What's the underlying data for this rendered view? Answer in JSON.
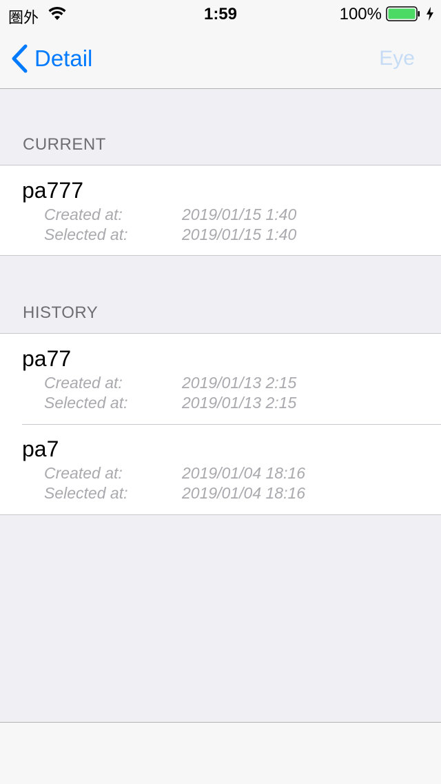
{
  "status_bar": {
    "carrier": "圏外",
    "time": "1:59",
    "battery_percent": "100%",
    "battery_level": 1.0,
    "battery_color": "#4cd964",
    "icons": [
      "wifi-icon",
      "battery-icon",
      "charging-icon"
    ]
  },
  "nav": {
    "back_label": "Detail",
    "right_label": "Eye",
    "tint_color": "#007aff"
  },
  "current": {
    "header": "CURRENT",
    "items": [
      {
        "title": "pa777",
        "created_label": "Created at:",
        "created_value": "2019/01/15 1:40",
        "selected_label": "Selected at:",
        "selected_value": "2019/01/15 1:40"
      }
    ]
  },
  "history": {
    "header": "HISTORY",
    "items": [
      {
        "title": "pa77",
        "created_label": "Created at:",
        "created_value": "2019/01/13 2:15",
        "selected_label": "Selected at:",
        "selected_value": "2019/01/13 2:15"
      },
      {
        "title": "pa7",
        "created_label": "Created at:",
        "created_value": "2019/01/04 18:16",
        "selected_label": "Selected at:",
        "selected_value": "2019/01/04 18:16"
      }
    ]
  }
}
